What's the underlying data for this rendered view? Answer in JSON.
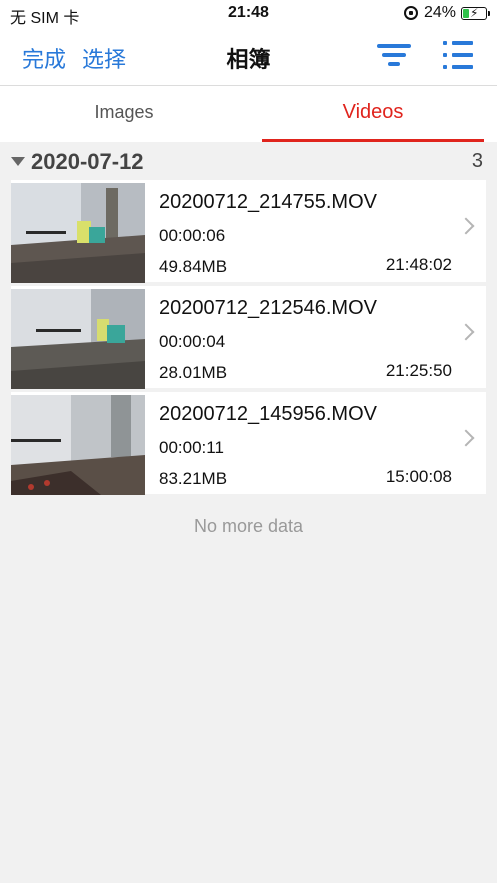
{
  "status_bar": {
    "carrier": "无 SIM 卡",
    "time": "21:48",
    "battery": "24%",
    "battery_level": 0.24
  },
  "nav": {
    "done": "完成",
    "select": "选择",
    "title": "相簿",
    "filter_icon": "filter-icon",
    "list_icon": "list-view-icon"
  },
  "tabs": [
    {
      "label": "Images",
      "active": false
    },
    {
      "label": "Videos",
      "active": true
    }
  ],
  "group": {
    "date": "2020-07-12",
    "count": "3"
  },
  "items": [
    {
      "name": "20200712_214755.MOV",
      "duration": "00:00:06",
      "size": "49.84MB",
      "time": "21:48:02"
    },
    {
      "name": "20200712_212546.MOV",
      "duration": "00:00:04",
      "size": "28.01MB",
      "time": "21:25:50"
    },
    {
      "name": "20200712_145956.MOV",
      "duration": "00:00:11",
      "size": "83.21MB",
      "time": "15:00:08"
    }
  ],
  "footer": {
    "no_more": "No more data"
  },
  "colors": {
    "accent_blue": "#2979d9",
    "accent_red": "#e0241d",
    "battery_green": "#2fc14a"
  }
}
